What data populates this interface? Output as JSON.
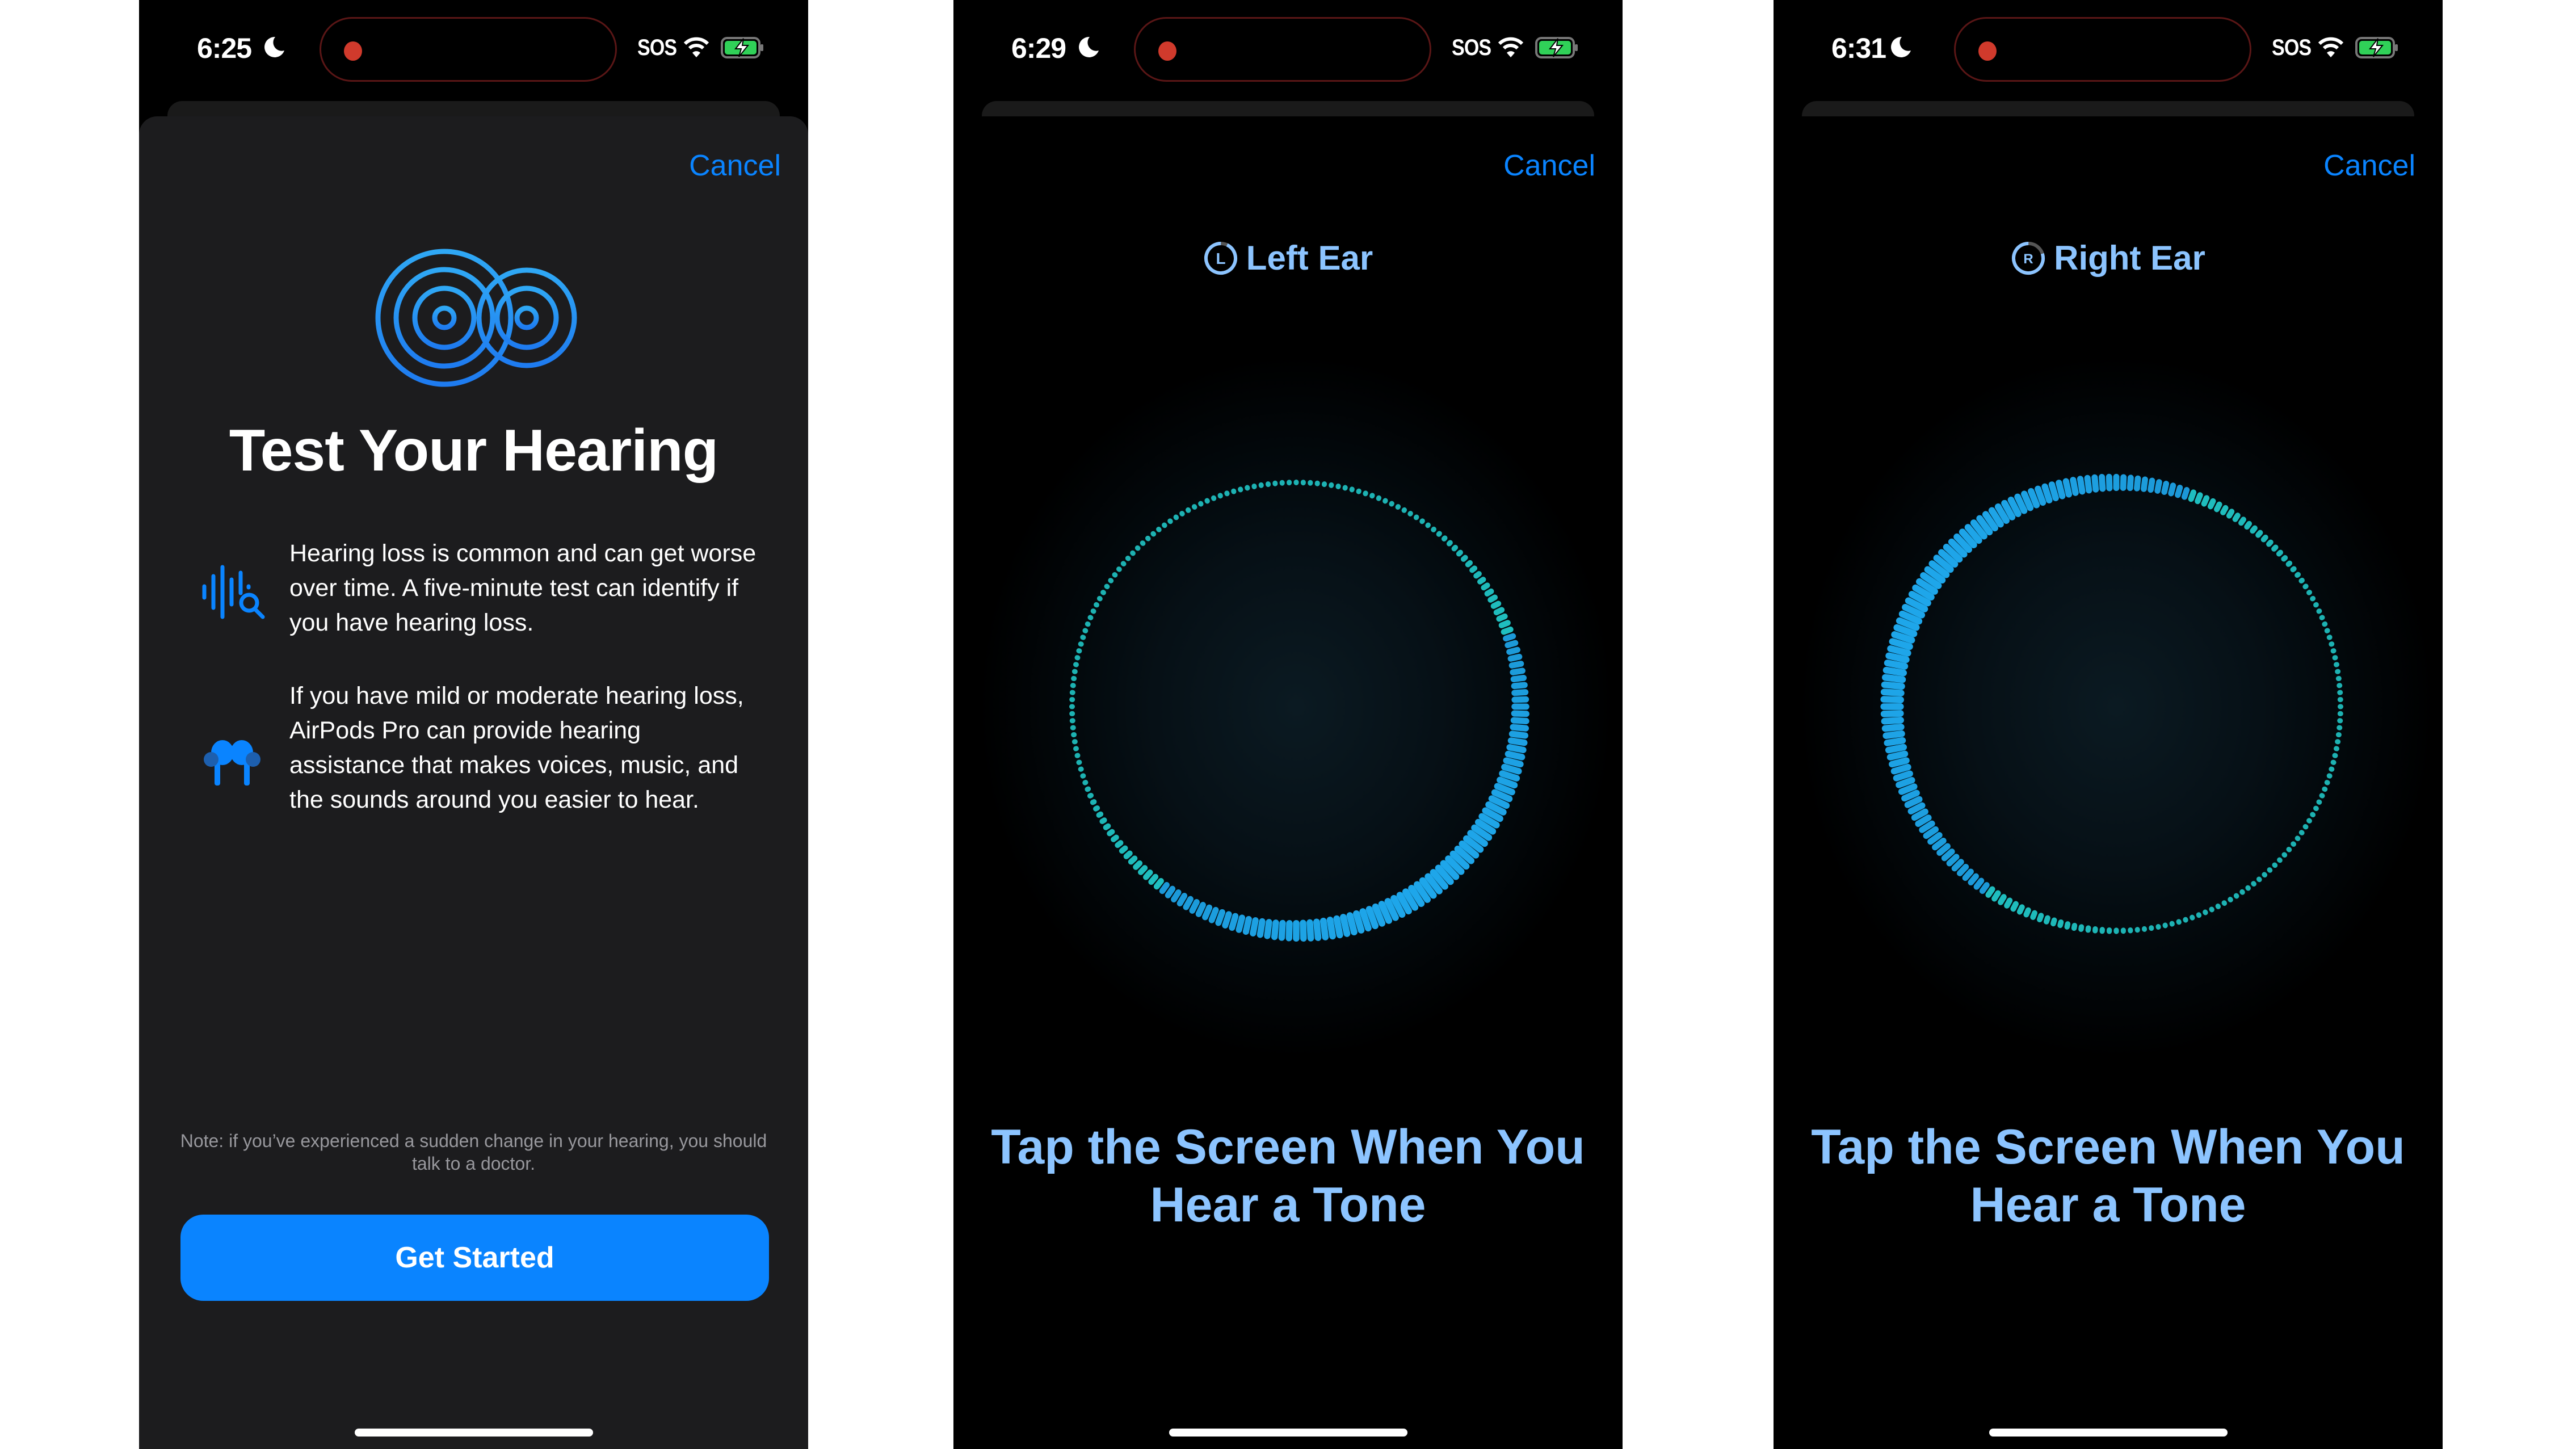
{
  "accent": "#0a84ff",
  "instruction_color": "#8cc4ff",
  "screens": [
    {
      "status": {
        "time": "6:25",
        "carrier": "SOS",
        "focus_icon": "moon-icon",
        "wifi_icon": "wifi-icon",
        "battery_icon": "battery-charging-icon"
      },
      "cancel_label": "Cancel",
      "hero_icon": "concentric-circles-hearing-icon",
      "title": "Test Your Hearing",
      "features": [
        {
          "icon": "waveform-magnifier-icon",
          "text": "Hearing loss is common and can get worse over time. A five-minute test can identify if you have hearing loss."
        },
        {
          "icon": "airpods-pro-icon",
          "text": "If you have mild or moderate hearing loss, AirPods Pro can provide hearing assistance that makes voices, music, and the sounds around you easier to hear."
        }
      ],
      "note": "Note: if you’ve experienced a sudden change in your hearing, you should talk to a doctor.",
      "primary_button": "Get Started"
    },
    {
      "status": {
        "time": "6:29",
        "carrier": "SOS",
        "focus_icon": "moon-icon",
        "wifi_icon": "wifi-icon",
        "battery_icon": "battery-charging-icon"
      },
      "cancel_label": "Cancel",
      "ear_badge": "L",
      "ear_label": "Left Ear",
      "ear_progress": 0.93,
      "ring_emphasis": "right-bottom",
      "instruction": "Tap the Screen When You Hear a Tone"
    },
    {
      "status": {
        "time": "6:31",
        "carrier": "SOS",
        "focus_icon": "moon-icon",
        "wifi_icon": "wifi-icon",
        "battery_icon": "battery-charging-icon"
      },
      "cancel_label": "Cancel",
      "ear_badge": "R",
      "ear_label": "Right Ear",
      "ear_progress": 0.8,
      "ring_emphasis": "left-top",
      "instruction": "Tap the Screen When You Hear a Tone"
    }
  ]
}
